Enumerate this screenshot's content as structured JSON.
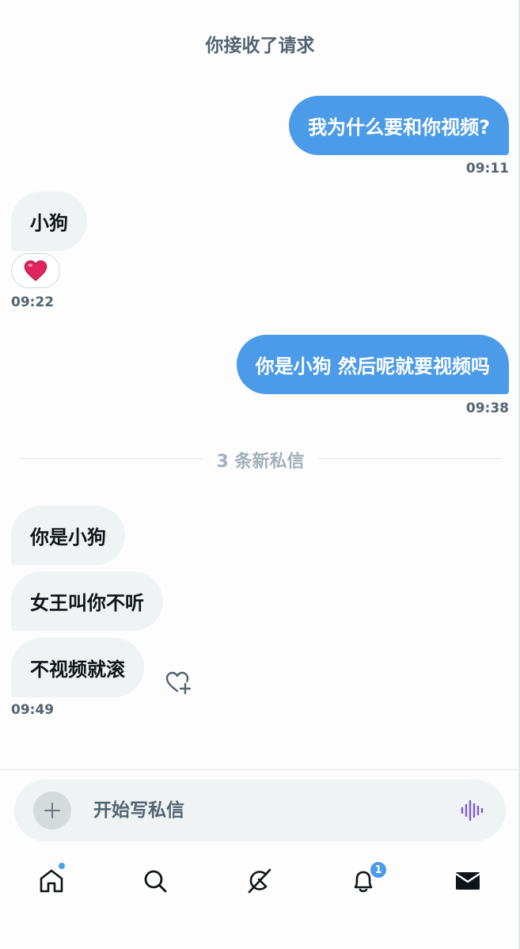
{
  "header": {
    "title": "你接收了请求"
  },
  "messages": [
    {
      "direction": "out",
      "text": "我为什么要和你视频?",
      "time": "09:11"
    },
    {
      "direction": "in",
      "text": "小狗",
      "reaction": "❤️",
      "time": "09:22"
    },
    {
      "direction": "out",
      "text": "你是小狗 然后呢就要视频吗",
      "time": "09:38"
    },
    {
      "direction": "in",
      "text": "你是小狗"
    },
    {
      "direction": "in",
      "text": "女王叫你不听"
    },
    {
      "direction": "in",
      "text": "不视频就滚",
      "time": "09:49"
    }
  ],
  "divider": {
    "label": "3 条新私信"
  },
  "composer": {
    "placeholder": "开始写私信",
    "value": ""
  },
  "tabbar": {
    "items": [
      {
        "icon": "home-icon",
        "has_dot": true
      },
      {
        "icon": "search-icon"
      },
      {
        "icon": "grok-icon"
      },
      {
        "icon": "bell-icon",
        "badge": "1"
      },
      {
        "icon": "mail-icon"
      }
    ]
  },
  "colors": {
    "accent": "#4c9be8",
    "incoming_bubble": "#eff3f4",
    "secondary_text": "#536471",
    "voice_icon": "#7b5cd6"
  }
}
